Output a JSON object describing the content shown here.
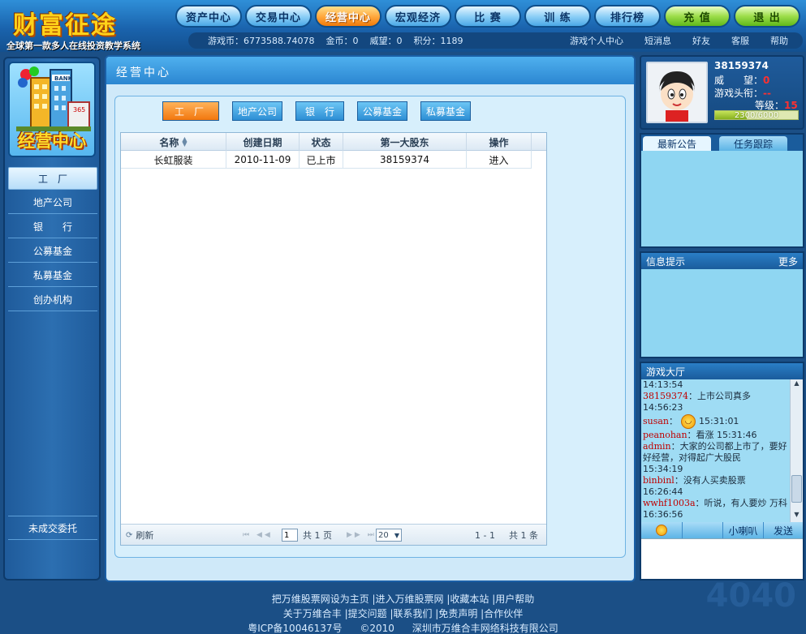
{
  "logo": {
    "title": "财富征途",
    "subtitle": "全球第一款多人在线投资教学系统"
  },
  "nav": [
    "资产中心",
    "交易中心",
    "经营中心",
    "宏观经济",
    "比 赛",
    "训 练",
    "排行榜",
    "充 值",
    "退 出"
  ],
  "stats": {
    "game_coins": "游戏币：6773588.74078",
    "gold": "金币：0",
    "prestige": "威望：0",
    "points": "积分：1189",
    "links": [
      "游戏个人中心",
      "短消息",
      "好友",
      "客服",
      "帮助"
    ]
  },
  "sidebar": {
    "badge": "经营中心",
    "items": [
      "工　厂",
      "地产公司",
      "银　　行",
      "公募基金",
      "私募基金",
      "创办机构"
    ],
    "bottom": "未成交委托"
  },
  "main": {
    "title": "经营中心",
    "tabs": [
      "工厂",
      "地产公司",
      "银　行",
      "公募基金",
      "私募基金"
    ],
    "columns": [
      "名称",
      "创建日期",
      "状态",
      "第一大股东",
      "操作"
    ],
    "rows": [
      {
        "name": "长虹服装",
        "date": "2010-11-09",
        "status": "已上市",
        "shareholder": "38159374",
        "action": "进入"
      }
    ],
    "footer": {
      "refresh": "刷新",
      "page": "1",
      "total_pages": "共 1 页",
      "page_size": "20",
      "range": "1 - 1",
      "count": "共 1 条"
    }
  },
  "profile": {
    "id": "38159374",
    "prestige_label": "威　　望：",
    "prestige_value": "0",
    "title_label": "游戏头衔：",
    "title_value": "--",
    "level_label": "等级：",
    "level_value": "15",
    "exp_text": "2300/6000",
    "exp_fraction": 0.383
  },
  "news_tabs": [
    "最新公告",
    "任务跟踪"
  ],
  "info": {
    "title": "信息提示",
    "more": "更多"
  },
  "hall": {
    "title": "游戏大厅",
    "messages": [
      {
        "time": "14:13:54"
      },
      {
        "user": "38159374",
        "text": "上市公司真多"
      },
      {
        "time": "14:56:23"
      },
      {
        "user": "susan",
        "text": "15:31:01",
        "emoji": true
      },
      {
        "user": "peanohan",
        "text": "看涨 15:31:46"
      },
      {
        "user": "admin",
        "text": "大家的公司都上市了，要好好经营，对得起广大股民"
      },
      {
        "time": "15:34:19"
      },
      {
        "user": "binbinl",
        "text": "没有人买卖股票"
      },
      {
        "time": "16:26:44"
      },
      {
        "user": "wwhf1003a",
        "text": "听说，有人要炒 万科 16:36:56"
      }
    ],
    "bar": [
      "小喇叭",
      "发送"
    ]
  },
  "footer": {
    "line1": "把万维股票网设为主页 |进入万维股票网 |收藏本站 |用户帮助",
    "line2": "关于万维合丰 |提交问题 |联系我们 |免责声明 |合作伙伴",
    "line3a": "粤ICP备10046137号",
    "line3b": "©2010",
    "line3c": "深圳市万维合丰网络科技有限公司"
  },
  "colors": {
    "accent": "#f2770e",
    "header": "#1a63ad",
    "panel": "#cfe9f9"
  }
}
